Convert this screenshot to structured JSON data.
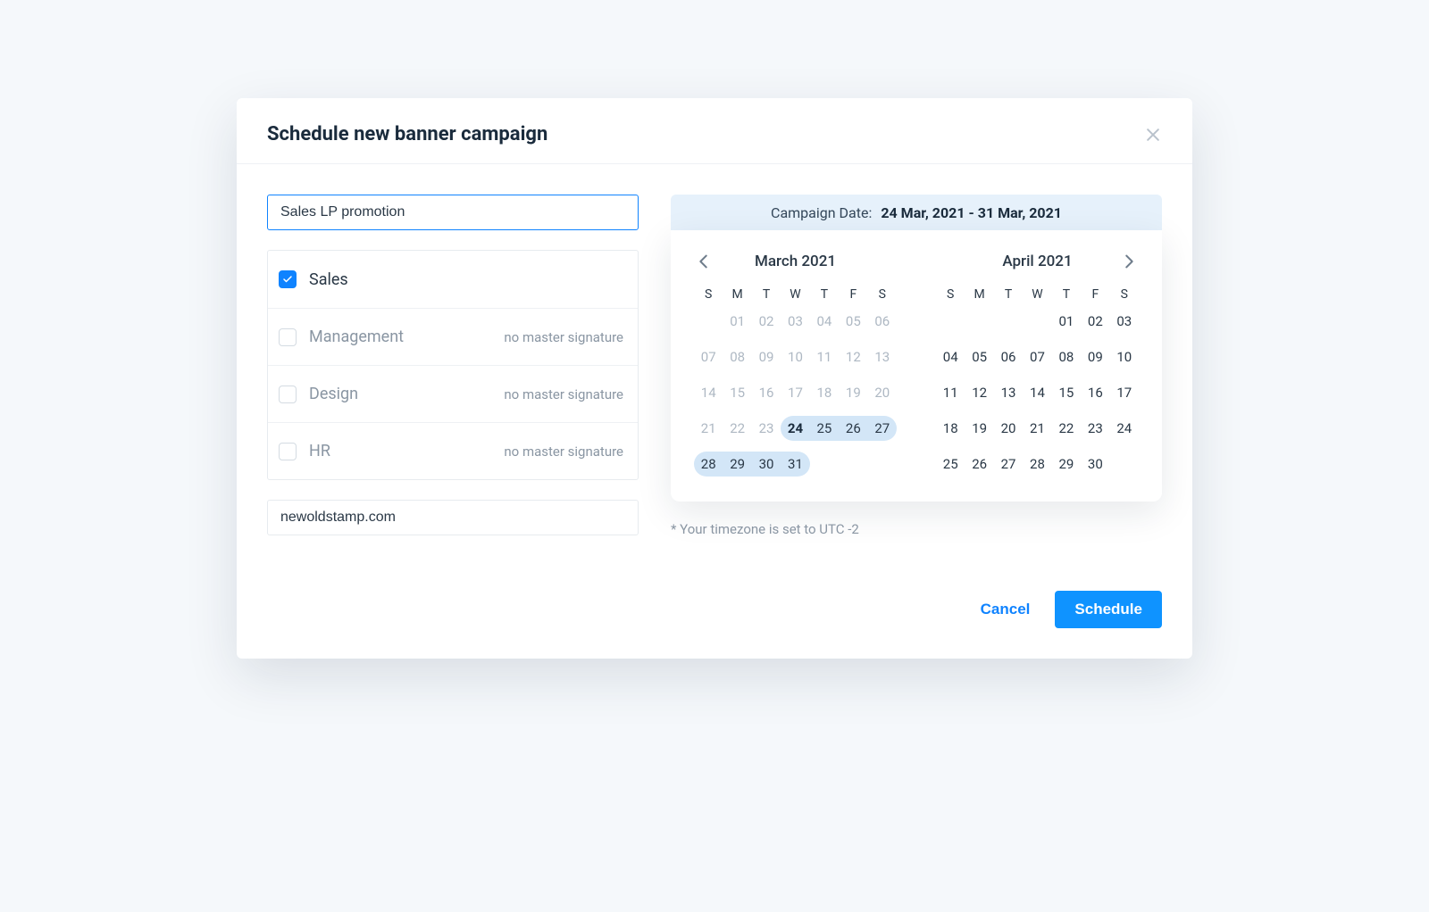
{
  "colors": {
    "accent": "#0f83ff",
    "selection": "#d3e6f7",
    "banner_bg": "#e6f1fb"
  },
  "modal": {
    "title": "Schedule new banner campaign"
  },
  "campaign": {
    "name_value": "Sales LP promotion",
    "url_value": "newoldstamp.com"
  },
  "departments": [
    {
      "name": "Sales",
      "checked": true,
      "note": ""
    },
    {
      "name": "Management",
      "checked": false,
      "note": "no master signature"
    },
    {
      "name": "Design",
      "checked": false,
      "note": "no master signature"
    },
    {
      "name": "HR",
      "checked": false,
      "note": "no master signature"
    }
  ],
  "date_banner": {
    "label": "Campaign Date:",
    "range": "24 Mar, 2021 - 31 Mar, 2021"
  },
  "calendar": {
    "dow": [
      "S",
      "M",
      "T",
      "W",
      "T",
      "F",
      "S"
    ],
    "months": [
      {
        "title": "March 2021",
        "leading_blanks": 1,
        "days": 31,
        "dim_until": 23,
        "range_start": 24,
        "range_end": 31
      },
      {
        "title": "April 2021",
        "leading_blanks": 4,
        "days": 30,
        "dim_until": 0,
        "range_start": 0,
        "range_end": 0
      }
    ]
  },
  "timezone_note": "* Your timezone is set to UTC -2",
  "footer": {
    "cancel": "Cancel",
    "schedule": "Schedule"
  }
}
